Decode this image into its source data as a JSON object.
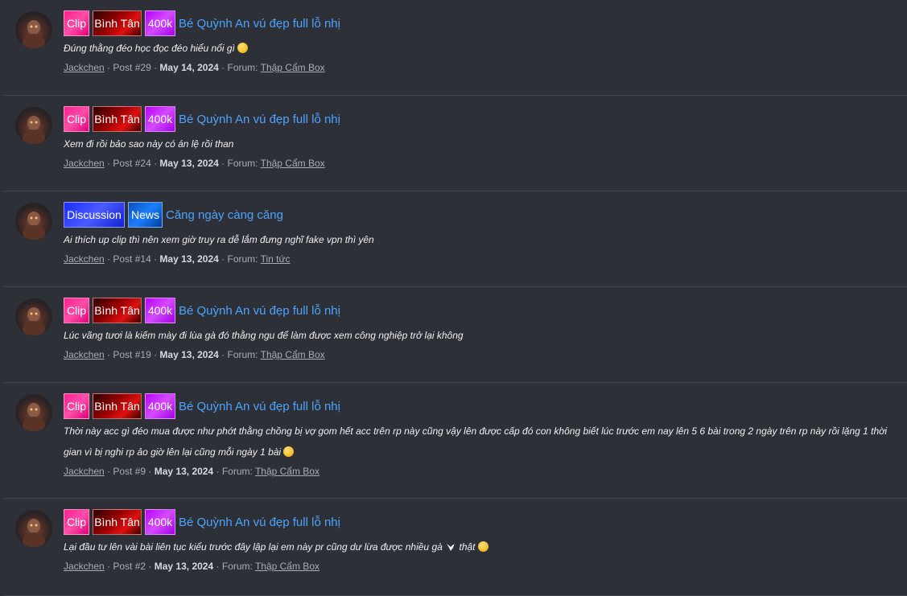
{
  "posts": [
    {
      "labels": [
        {
          "text": "Clip",
          "kind": "clip"
        },
        {
          "text": "Bình Tân",
          "kind": "binhtan"
        },
        {
          "text": "400k",
          "kind": "400k"
        }
      ],
      "title": "Bé Quỳnh An vú đẹp full lỗ nhị",
      "snippet": "Đúng thằng đéo học đọc đéo hiểu nổi gì",
      "snippet_emoji": "laugh-emoji",
      "author": "Jackchen",
      "post_no": "Post #29",
      "date": "May 14, 2024",
      "forum_prefix": "Forum:",
      "forum": "Thập Cẩm Box"
    },
    {
      "labels": [
        {
          "text": "Clip",
          "kind": "clip"
        },
        {
          "text": "Bình Tân",
          "kind": "binhtan"
        },
        {
          "text": "400k",
          "kind": "400k"
        }
      ],
      "title": "Bé Quỳnh An vú đẹp full lỗ nhị",
      "snippet": "Xem đi rồi bảo sao này có án lệ rồi than",
      "author": "Jackchen",
      "post_no": "Post #24",
      "date": "May 13, 2024",
      "forum_prefix": "Forum:",
      "forum": "Thập Cẩm Box"
    },
    {
      "labels": [
        {
          "text": "Discussion",
          "kind": "discussion"
        },
        {
          "text": "News",
          "kind": "news"
        }
      ],
      "title": "Căng ngày càng căng",
      "snippet": "Ai thích up clip thì nên xem giờ truy ra dễ lắm đưng nghĩ fake vpn thì yên",
      "author": "Jackchen",
      "post_no": "Post #14",
      "date": "May 13, 2024",
      "forum_prefix": "Forum:",
      "forum": "Tin tức"
    },
    {
      "labels": [
        {
          "text": "Clip",
          "kind": "clip"
        },
        {
          "text": "Bình Tân",
          "kind": "binhtan"
        },
        {
          "text": "400k",
          "kind": "400k"
        }
      ],
      "title": "Bé Quỳnh An vú đẹp full lỗ nhị",
      "snippet": "Lúc vãng tươi là kiếm mày đi lùa gà đó thằng ngu để làm được xem công nghiệp trở lại không",
      "author": "Jackchen",
      "post_no": "Post #19",
      "date": "May 13, 2024",
      "forum_prefix": "Forum:",
      "forum": "Thập Cẩm Box"
    },
    {
      "labels": [
        {
          "text": "Clip",
          "kind": "clip"
        },
        {
          "text": "Bình Tân",
          "kind": "binhtan"
        },
        {
          "text": "400k",
          "kind": "400k"
        }
      ],
      "title": "Bé Quỳnh An vú đẹp full lỗ nhị",
      "snippet": "Thời này acc gì đéo mua được như phớt thằng chồng bị vợ gom hết acc trên rp này cũng vậy lên được cấp đó con không biết lúc trước em nay lên 5 6 bài trong 2 ngày trên rp này rồi lặng 1 thời gian vì bị nghi rp ảo giờ lên lại cũng mỗi ngày 1 bài",
      "snippet_emoji": "laugh-emoji",
      "author": "Jackchen",
      "post_no": "Post #9",
      "date": "May 13, 2024",
      "forum_prefix": "Forum:",
      "forum": "Thập Cẩm Box"
    },
    {
      "labels": [
        {
          "text": "Clip",
          "kind": "clip"
        },
        {
          "text": "Bình Tân",
          "kind": "binhtan"
        },
        {
          "text": "400k",
          "kind": "400k"
        }
      ],
      "title": "Bé Quỳnh An vú đẹp full lỗ nhị",
      "snippet": "Lại đầu tư lên vài bài liên tục kiểu trước đây lập lại em này pr cũng dư lừa được nhiều gà",
      "snippet_tail": "thật",
      "snippet_emoji": "laugh-emoji",
      "author": "Jackchen",
      "post_no": "Post #2",
      "date": "May 13, 2024",
      "forum_prefix": "Forum:",
      "forum": "Thập Cẩm Box"
    }
  ]
}
